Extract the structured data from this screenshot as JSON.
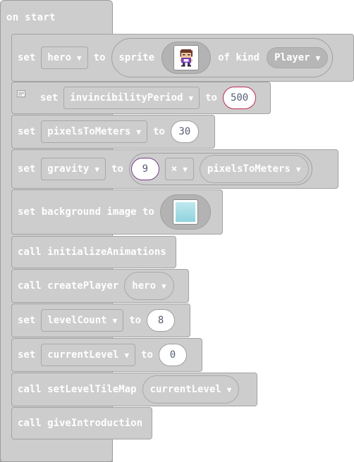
{
  "hat": {
    "label": "on start"
  },
  "blocks": {
    "set_hero": {
      "kw_set": "set",
      "var": "hero",
      "kw_to": "to",
      "kw_sprite": "sprite",
      "kw_of_kind": "of kind",
      "kind": "Player",
      "sprite_icon": "pixel-character-sprite"
    },
    "set_invincibility": {
      "kw_set": "set",
      "var": "invincibilityPeriod",
      "kw_to": "to",
      "value": "500"
    },
    "set_pixels": {
      "kw_set": "set",
      "var": "pixelsToMeters",
      "kw_to": "to",
      "value": "30"
    },
    "set_gravity": {
      "kw_set": "set",
      "var": "gravity",
      "kw_to": "to",
      "value": "9",
      "op": "×",
      "operand": "pixelsToMeters"
    },
    "set_background": {
      "label": "set background image to",
      "image_icon": "background-image-thumbnail"
    },
    "call_init": {
      "label": "call initializeAnimations"
    },
    "call_create": {
      "label": "call createPlayer",
      "arg": "hero"
    },
    "set_levelcount": {
      "kw_set": "set",
      "var": "levelCount",
      "kw_to": "to",
      "value": "8"
    },
    "set_currentlevel": {
      "kw_set": "set",
      "var": "currentLevel",
      "kw_to": "to",
      "value": "0"
    },
    "call_tilemap": {
      "label": "call setLevelTileMap",
      "arg": "currentLevel"
    },
    "call_intro": {
      "label": "call giveIntroduction"
    }
  },
  "colors": {
    "block": "#cdcdcd",
    "text": "#ffffff",
    "number_text": "#575e75",
    "highlight": "#bb2b50"
  },
  "dropdown_arrow": "▼"
}
